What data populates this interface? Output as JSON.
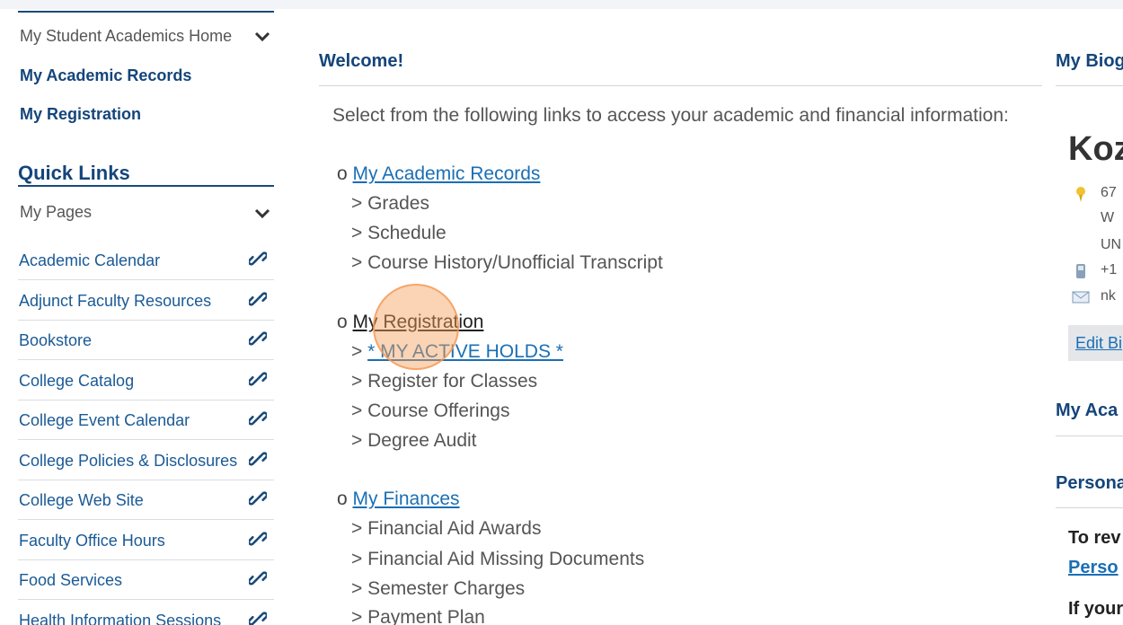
{
  "sidebar": {
    "nav": [
      {
        "label": "My Student Academics Home"
      },
      {
        "label": "My Academic Records"
      },
      {
        "label": "My Registration"
      }
    ],
    "quick_links_title": "Quick Links",
    "my_pages_label": "My Pages",
    "links": [
      {
        "label": "Academic Calendar"
      },
      {
        "label": "Adjunct Faculty Resources"
      },
      {
        "label": "Bookstore"
      },
      {
        "label": "College Catalog"
      },
      {
        "label": "College Event Calendar"
      },
      {
        "label": "College Policies & Disclosures"
      },
      {
        "label": "College Web Site"
      },
      {
        "label": "Faculty Office Hours"
      },
      {
        "label": "Food Services"
      },
      {
        "label": "Health Information Sessions"
      }
    ]
  },
  "main": {
    "welcome_title": "Welcome!",
    "intro": "Select from the following links to access your academic and financial information:",
    "bullet": "o",
    "sections": [
      {
        "title": "My Academic Records",
        "items": [
          "> Grades",
          "> Schedule",
          "> Course History/Unofficial Transcript"
        ]
      },
      {
        "title": "My Registration",
        "hold_prefix": ">",
        "hold_link": "* MY ACTIVE HOLDS *",
        "items": [
          "> Register for Classes",
          "> Course Offerings",
          "> Degree Audit"
        ]
      },
      {
        "title": "My Finances",
        "items": [
          "> Financial Aid Awards",
          "> Financial Aid Missing Documents",
          "> Semester Charges",
          "> Payment Plan"
        ]
      }
    ]
  },
  "right": {
    "bio_title": "My Biog",
    "name": "Koz",
    "address": [
      "67",
      "W",
      "UN"
    ],
    "phone": "+1",
    "email": "nk",
    "edit_label": "Edit Bi",
    "academics_title": "My Aca",
    "personal_title": "Persona",
    "review_text": "To rev",
    "person_link": "Perso",
    "if_text": "If your"
  },
  "colors": {
    "navy": "#14457a",
    "link": "#1a6fb5",
    "click_highlight": "#f5a05a"
  }
}
